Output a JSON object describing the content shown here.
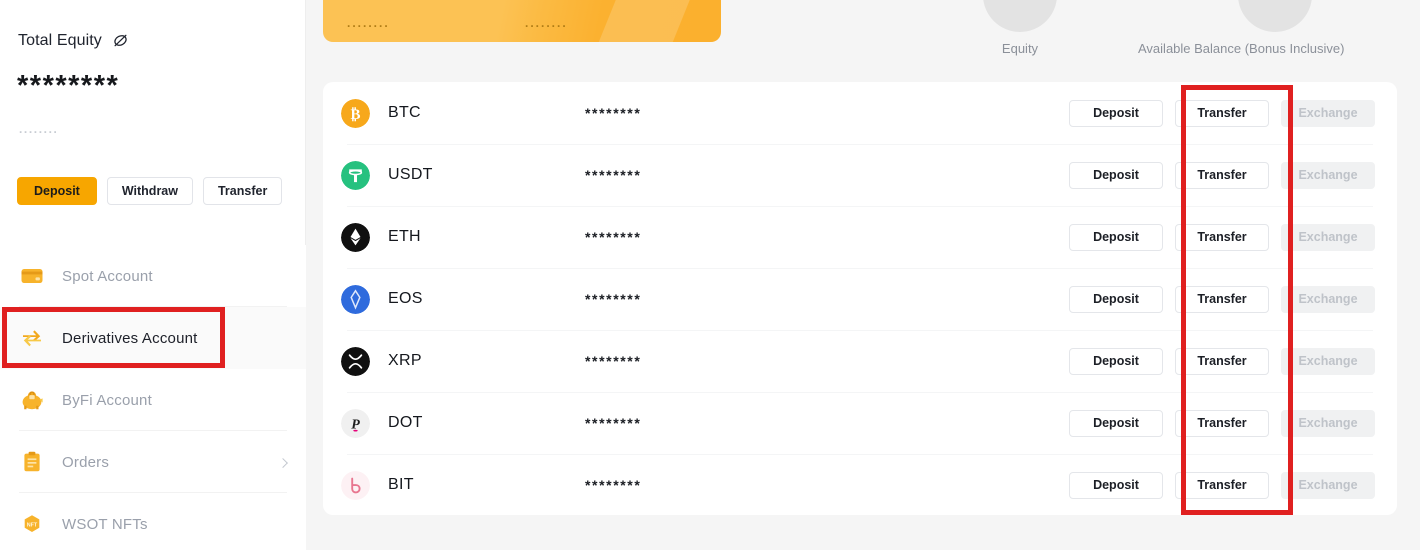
{
  "sidebar": {
    "equity_label": "Total Equity",
    "eye_icon": "eye-off-icon",
    "equity_value": "********",
    "equity_sub": "........",
    "buttons": [
      {
        "label": "Deposit",
        "primary": true
      },
      {
        "label": "Withdraw",
        "primary": false
      },
      {
        "label": "Transfer",
        "primary": false
      }
    ],
    "items": [
      {
        "label": "Spot Account",
        "icon": "wallet-card-icon",
        "active": false,
        "chevron": false
      },
      {
        "label": "Derivatives Account",
        "icon": "transfer-arrows-icon",
        "active": true,
        "chevron": false
      },
      {
        "label": "ByFi Account",
        "icon": "piggy-bank-lock-icon",
        "active": false,
        "chevron": false
      },
      {
        "label": "Orders",
        "icon": "clipboard-icon",
        "active": false,
        "chevron": true
      },
      {
        "label": "WSOT NFTs",
        "icon": "nft-hexagon-icon",
        "active": false,
        "chevron": false
      }
    ]
  },
  "promo": {
    "masked_left": "........",
    "masked_right": "........"
  },
  "stats": [
    {
      "label": "Equity"
    },
    {
      "label": "Available Balance (Bonus Inclusive)"
    }
  ],
  "table": {
    "actions": {
      "deposit": "Deposit",
      "transfer": "Transfer",
      "exchange": "Exchange"
    },
    "rows": [
      {
        "coin": "BTC",
        "amount": "********",
        "icon": "btc-icon"
      },
      {
        "coin": "USDT",
        "amount": "********",
        "icon": "usdt-icon"
      },
      {
        "coin": "ETH",
        "amount": "********",
        "icon": "eth-icon"
      },
      {
        "coin": "EOS",
        "amount": "********",
        "icon": "eos-icon"
      },
      {
        "coin": "XRP",
        "amount": "********",
        "icon": "xrp-icon"
      },
      {
        "coin": "DOT",
        "amount": "********",
        "icon": "dot-icon"
      },
      {
        "coin": "BIT",
        "amount": "********",
        "icon": "bit-icon"
      }
    ]
  },
  "annotations": {
    "colors": {
      "highlight": "#e02020",
      "brand": "#f7a600"
    },
    "boxes": [
      {
        "name": "derivatives-account-highlight"
      },
      {
        "name": "transfer-column-highlight"
      }
    ]
  }
}
